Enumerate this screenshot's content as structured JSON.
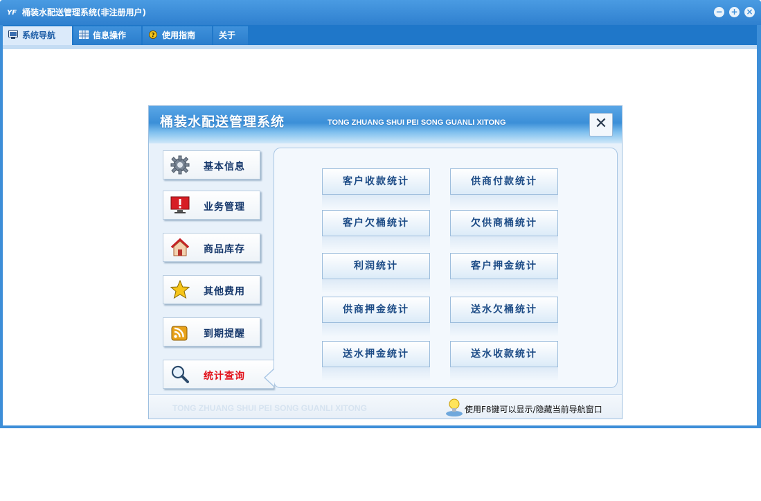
{
  "window": {
    "title": "桶装水配送管理系统(非注册用户)",
    "app_icon_text": "YF"
  },
  "menubar": {
    "items": [
      {
        "label": "系统导航",
        "active": true
      },
      {
        "label": "信息操作",
        "active": false
      },
      {
        "label": "使用指南",
        "active": false
      },
      {
        "label": "关于",
        "active": false
      }
    ]
  },
  "dialog": {
    "title": "桶装水配送管理系统",
    "subtitle": "TONG ZHUANG SHUI PEI SONG GUANLI XITONG",
    "close_glyph": "✕",
    "nav": [
      {
        "label": "基本信息",
        "icon": "gear-icon"
      },
      {
        "label": "业务管理",
        "icon": "alert-monitor-icon"
      },
      {
        "label": "商品库存",
        "icon": "home-icon"
      },
      {
        "label": "其他费用",
        "icon": "star-icon"
      },
      {
        "label": "到期提醒",
        "icon": "rss-icon"
      },
      {
        "label": "统计查询",
        "icon": "magnifier-icon",
        "active": true
      }
    ],
    "buttons": [
      "客户收款统计",
      "供商付款统计",
      "客户欠桶统计",
      "欠供商桶统计",
      "利润统计",
      "客户押金统计",
      "供商押金统计",
      "送水欠桶统计",
      "送水押金统计",
      "送水收款统计"
    ],
    "footer_left": "TONG ZHUANG SHUI PEI SONG GUANLI XITONG",
    "footer_tip": "使用F8键可以显示/隐藏当前导航窗口"
  },
  "colors": {
    "titlebar": "#3d8ed8",
    "menubar": "#1f77c9",
    "active_nav_text": "#e2121b",
    "button_text": "#1c4b86"
  }
}
